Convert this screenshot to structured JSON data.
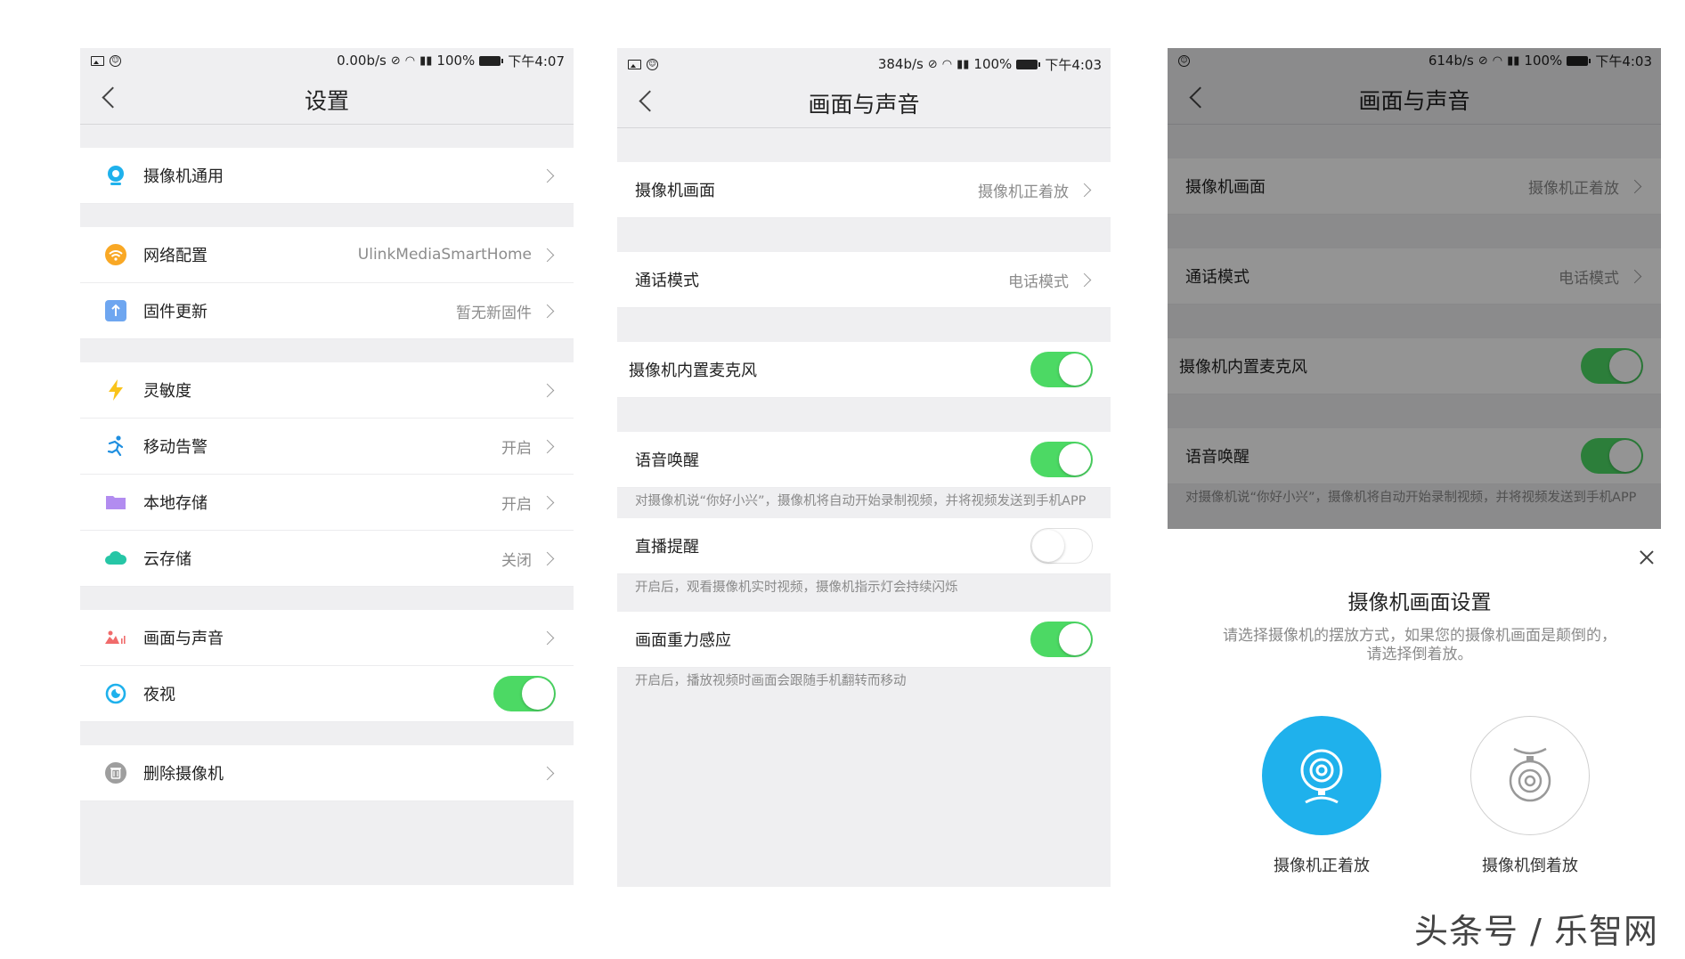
{
  "colors": {
    "toggle_on": "#4cd964",
    "accent_blue": "#1fb1ec",
    "background": "#efeff1"
  },
  "screen1": {
    "status": {
      "speed": "0.00b/s",
      "battery": "100%",
      "time": "下午4:07"
    },
    "title": "设置",
    "items": [
      {
        "label": "摄像机通用",
        "value": "",
        "icon": "camera-pin-icon"
      },
      {
        "label": "网络配置",
        "value": "UlinkMediaSmartHome",
        "icon": "wifi-icon"
      },
      {
        "label": "固件更新",
        "value": "暂无新固件",
        "icon": "upload-icon"
      },
      {
        "label": "灵敏度",
        "value": "",
        "icon": "lightning-icon"
      },
      {
        "label": "移动告警",
        "value": "开启",
        "icon": "running-icon"
      },
      {
        "label": "本地存储",
        "value": "开启",
        "icon": "folder-icon"
      },
      {
        "label": "云存储",
        "value": "关闭",
        "icon": "cloud-icon"
      },
      {
        "label": "画面与声音",
        "value": "",
        "icon": "picture-sound-icon"
      },
      {
        "label": "夜视",
        "value": "",
        "icon": "night-vision-icon",
        "toggle": "on"
      },
      {
        "label": "删除摄像机",
        "value": "",
        "icon": "trash-icon"
      }
    ]
  },
  "screen2": {
    "status": {
      "speed": "384b/s",
      "battery": "100%",
      "time": "下午4:03"
    },
    "title": "画面与声音",
    "items": [
      {
        "label": "摄像机画面",
        "value": "摄像机正着放"
      },
      {
        "label": "通话模式",
        "value": "电话模式"
      },
      {
        "label": "摄像机内置麦克风",
        "toggle": "on"
      },
      {
        "label": "语音唤醒",
        "toggle": "on",
        "note": "对摄像机说“你好小兴”，摄像机将自动开始录制视频，并将视频发送到手机APP"
      },
      {
        "label": "直播提醒",
        "toggle": "off",
        "note": "开启后，观看摄像机实时视频，摄像机指示灯会持续闪烁"
      },
      {
        "label": "画面重力感应",
        "toggle": "on",
        "note": "开启后，播放视频时画面会跟随手机翻转而移动"
      }
    ]
  },
  "screen3": {
    "status": {
      "speed": "614b/s",
      "battery": "100%",
      "time": "下午4:03"
    },
    "title": "画面与声音",
    "items": [
      {
        "label": "摄像机画面",
        "value": "摄像机正着放"
      },
      {
        "label": "通话模式",
        "value": "电话模式"
      },
      {
        "label": "摄像机内置麦克风",
        "toggle": "on"
      },
      {
        "label": "语音唤醒",
        "toggle": "on",
        "note": "对摄像机说“你好小兴”，摄像机将自动开始录制视频，并将视频发送到手机APP"
      }
    ],
    "sheet": {
      "title": "摄像机画面设置",
      "desc": "请选择摄像机的摆放方式，如果您的摄像机画面是颠倒的，请选择倒着放。",
      "option_up": "摄像机正着放",
      "option_down": "摄像机倒着放"
    }
  },
  "watermark": "头条号 / 乐智网"
}
